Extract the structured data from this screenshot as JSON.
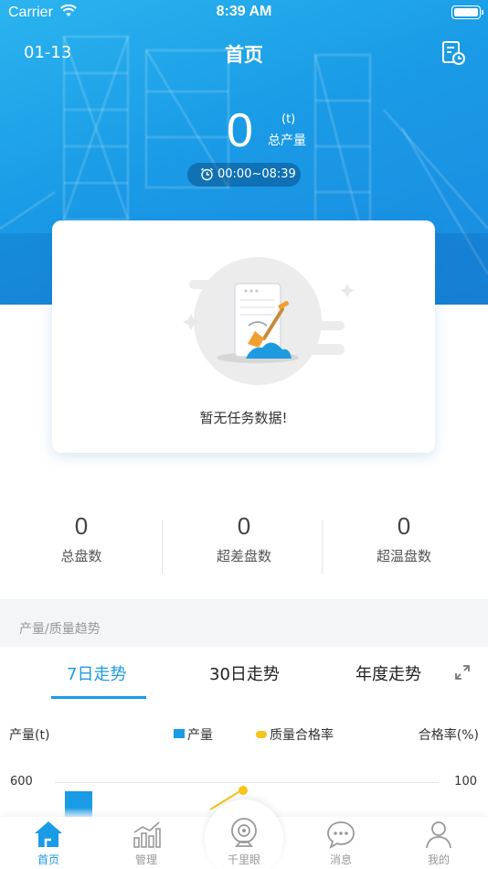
{
  "status_bar": {
    "carrier": "Carrier",
    "time": "8:39 AM"
  },
  "header": {
    "date": "01-13",
    "title": "首页"
  },
  "summary": {
    "total_value": "0",
    "unit": "(t)",
    "label": "总产量",
    "time_range": "00:00~08:39"
  },
  "task_card": {
    "empty_text": "暂无任务数据!"
  },
  "stats": [
    {
      "value": "0",
      "label": "总盘数"
    },
    {
      "value": "0",
      "label": "超差盘数"
    },
    {
      "value": "0",
      "label": "超温盘数"
    }
  ],
  "trend": {
    "section_title": "产量/质量趋势",
    "tabs": [
      "7日走势",
      "30日走势",
      "年度走势"
    ],
    "active_tab": 0
  },
  "chart_data": {
    "type": "bar",
    "ylabel_left": "产量(t)",
    "ylabel_right": "合格率(%)",
    "series": [
      {
        "name": "产量",
        "type": "bar"
      },
      {
        "name": "质量合格率",
        "type": "line"
      }
    ],
    "left_ticks": [
      "600"
    ],
    "right_ticks": [
      "100"
    ]
  },
  "tabbar": {
    "items": [
      "首页",
      "管理",
      "千里眼",
      "消息",
      "我的"
    ],
    "active": 0
  },
  "colors": {
    "primary": "#1a9be6",
    "accent": "#f5c518"
  }
}
